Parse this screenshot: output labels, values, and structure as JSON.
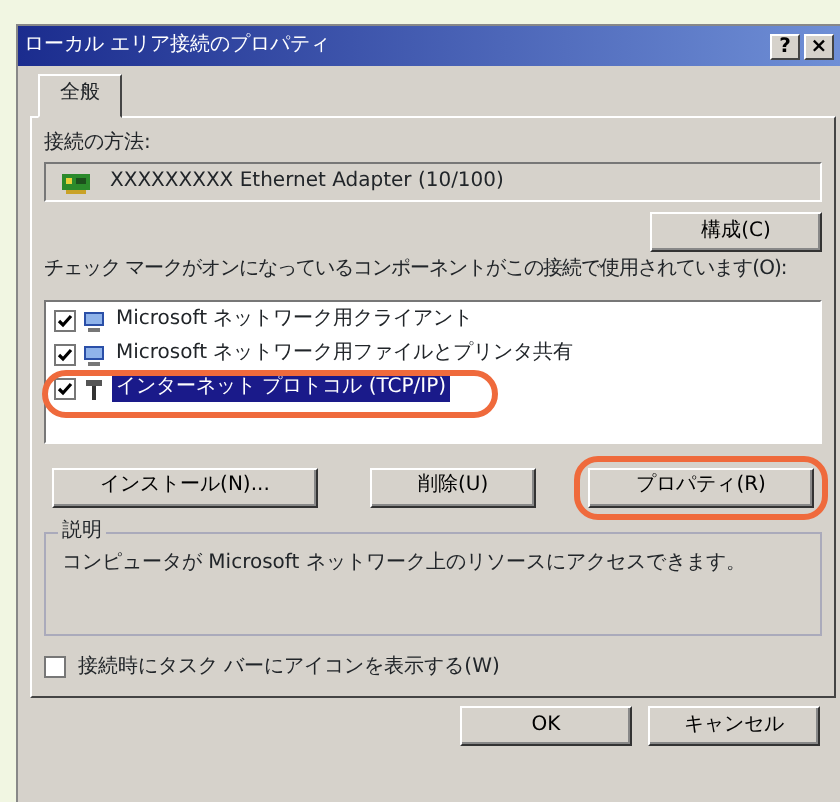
{
  "window": {
    "title": "ローカル エリア接続のプロパティ",
    "title_buttons": [
      "?",
      "×"
    ]
  },
  "tabs": [
    {
      "label": "全般",
      "selected": true
    }
  ],
  "connect_using": {
    "label": "接続の方法:",
    "adapter": "XXXXXXXXX Ethernet Adapter (10/100)",
    "configure_button": "構成(C)"
  },
  "components": {
    "label": "チェック マークがオンになっているコンポーネントがこの接続で使用されています(O):",
    "items": [
      {
        "label": "Microsoft ネットワーク用クライアント",
        "kind": "client",
        "checked": true,
        "selected": false,
        "highlighted": false
      },
      {
        "label": "Microsoft ネットワーク用ファイルとプリンタ共有",
        "kind": "client",
        "checked": true,
        "selected": false,
        "highlighted": false
      },
      {
        "label": "インターネット プロトコル (TCP/IP)",
        "kind": "protocol",
        "checked": true,
        "selected": true,
        "highlighted": true
      }
    ]
  },
  "component_buttons": [
    {
      "label": "インストール(N)...",
      "highlighted": false
    },
    {
      "label": "削除(U)",
      "highlighted": false
    },
    {
      "label": "プロパティ(R)",
      "highlighted": true
    }
  ],
  "description": {
    "title": "説明",
    "text": "コンピュータが Microsoft ネットワーク上のリソースにアクセスできます。"
  },
  "show_icon": {
    "label": "接続時にタスク バーにアイコンを表示する(W)",
    "checked": false
  },
  "dialog_buttons": [
    "OK",
    "キャンセル"
  ]
}
